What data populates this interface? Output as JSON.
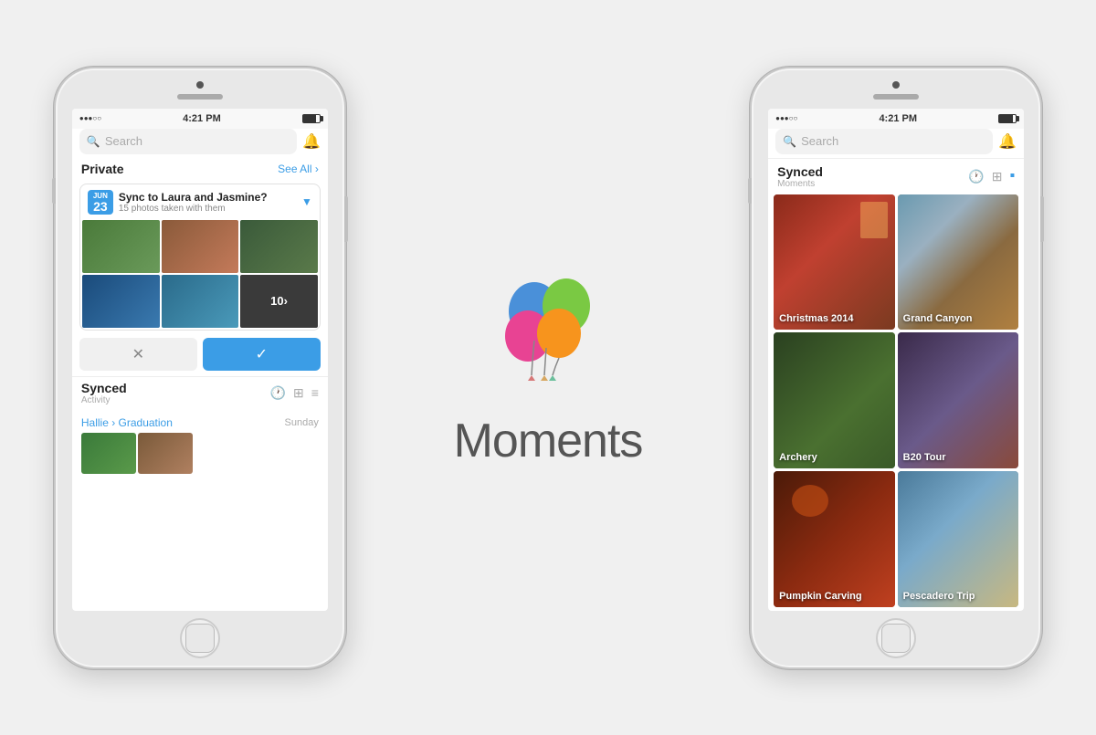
{
  "app": {
    "name": "Moments",
    "tagline": "Moments"
  },
  "phone_left": {
    "status": {
      "time": "4:21 PM",
      "signal": "●●●○○",
      "battery": "80"
    },
    "search": {
      "placeholder": "Search"
    },
    "private_section": {
      "title": "Private",
      "see_all": "See All ›"
    },
    "sync_card": {
      "date_month": "JUN",
      "date_day": "23",
      "title": "Sync to Laura and Jasmine?",
      "subtitle": "15 photos taken with them",
      "more_count": "10›"
    },
    "action_cancel": "✕",
    "action_confirm": "✓",
    "synced_section": {
      "title": "Synced",
      "subtitle": "Activity"
    },
    "activity": {
      "names": "Hallie › Graduation",
      "day": "Sunday"
    }
  },
  "phone_right": {
    "status": {
      "time": "4:21 PM"
    },
    "search": {
      "placeholder": "Search"
    },
    "synced_section": {
      "title": "Synced",
      "subtitle": "Moments"
    },
    "moments": [
      {
        "label": "Christmas 2014",
        "bg": "moment-christmas"
      },
      {
        "label": "Grand Canyon",
        "bg": "moment-canyon"
      },
      {
        "label": "Archery",
        "bg": "moment-archery"
      },
      {
        "label": "B20 Tour",
        "bg": "moment-b20"
      },
      {
        "label": "Pumpkin Carving",
        "bg": "moment-pumpkin"
      },
      {
        "label": "Pescadero Trip",
        "bg": "moment-pescadero"
      }
    ]
  }
}
